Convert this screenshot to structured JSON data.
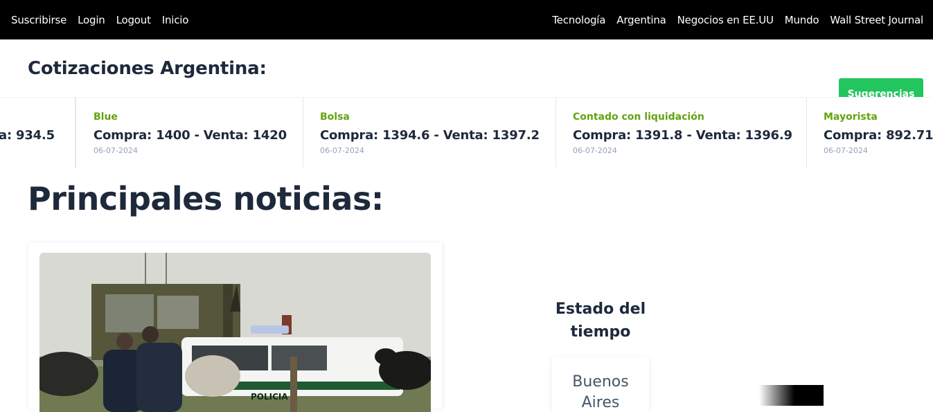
{
  "nav": {
    "left": [
      "Suscribirse",
      "Login",
      "Logout",
      "Inicio"
    ],
    "right": [
      "Tecnología",
      "Argentina",
      "Negocios en EE.UU",
      "Mundo",
      "Wall Street Journal"
    ]
  },
  "cotizaciones": {
    "title": "Cotizaciones Argentina:",
    "button": "Sugerencias",
    "items": [
      {
        "name": "",
        "values": "a: 934.5",
        "date": ""
      },
      {
        "name": "Blue",
        "values": "Compra: 1400 - Venta: 1420",
        "date": "06-07-2024"
      },
      {
        "name": "Bolsa",
        "values": "Compra: 1394.6 - Venta: 1397.2",
        "date": "06-07-2024"
      },
      {
        "name": "Contado con liquidación",
        "values": "Compra: 1391.8 - Venta: 1396.9",
        "date": "06-07-2024"
      },
      {
        "name": "Mayorista",
        "values": "Compra: 892.71",
        "date": "06-07-2024"
      }
    ]
  },
  "news": {
    "title": "Principales noticias:",
    "image_alt_subject": "POLICIA",
    "plate_text": "POLICIA"
  },
  "weather": {
    "title": "Estado del tiempo",
    "city": "Buenos Aires"
  },
  "colors": {
    "nav_bg": "#000000",
    "accent_green": "#22c55e",
    "quote_name": "#65a30d",
    "heading": "#1e293b"
  }
}
